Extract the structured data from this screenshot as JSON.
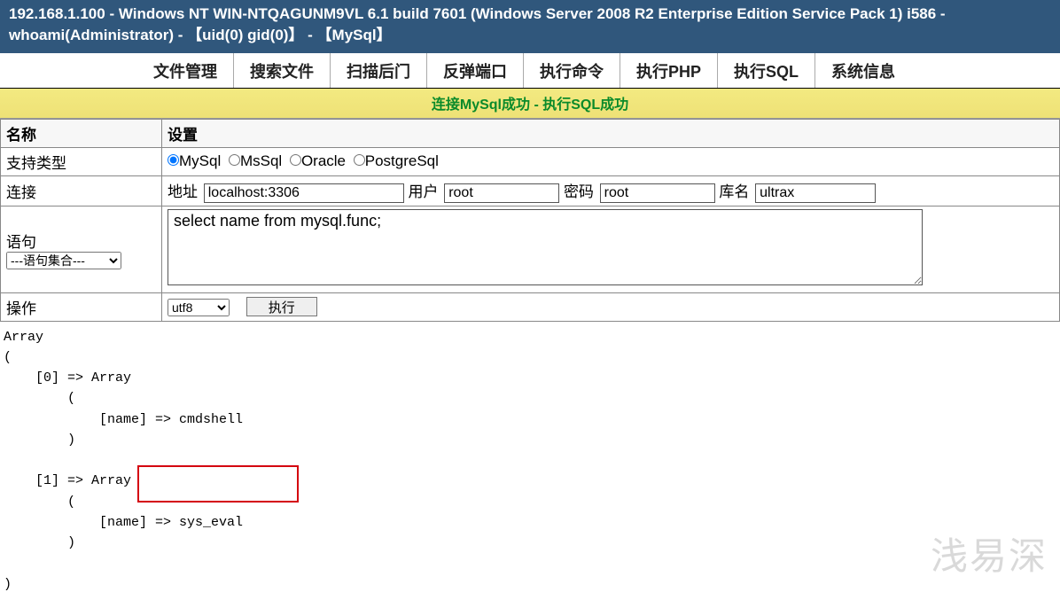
{
  "header": {
    "title": "192.168.1.100 - Windows NT WIN-NTQAGUNM9VL 6.1 build 7601 (Windows Server 2008 R2 Enterprise Edition Service Pack 1) i586 - whoami(Administrator) - 【uid(0) gid(0)】 - 【MySql】"
  },
  "tabs": [
    {
      "label": "文件管理"
    },
    {
      "label": "搜索文件"
    },
    {
      "label": "扫描后门"
    },
    {
      "label": "反弹端口"
    },
    {
      "label": "执行命令"
    },
    {
      "label": "执行PHP"
    },
    {
      "label": "执行SQL",
      "active": true
    },
    {
      "label": "系统信息"
    }
  ],
  "status": "连接MySql成功 - 执行SQL成功",
  "form": {
    "header_name": "名称",
    "header_setting": "设置",
    "row_type_label": "支持类型",
    "db_types": [
      "MySql",
      "MsSql",
      "Oracle",
      "PostgreSql"
    ],
    "db_type_selected": "MySql",
    "row_conn_label": "连接",
    "conn": {
      "addr_label": "地址",
      "addr_value": "localhost:3306",
      "user_label": "用户",
      "user_value": "root",
      "pass_label": "密码",
      "pass_value": "root",
      "db_label": "库名",
      "db_value": "ultrax"
    },
    "row_stmt_label": "语句",
    "stmt_set_placeholder": "---语句集合---",
    "sql_value": "select name from mysql.func;",
    "row_action_label": "操作",
    "encoding": "utf8",
    "exec_label": "执行"
  },
  "output": "Array\n(\n    [0] => Array\n        (\n            [name] => cmdshell\n        )\n\n    [1] => Array\n        (\n            [name] => sys_eval\n        )\n\n)",
  "watermark": "浅易深"
}
